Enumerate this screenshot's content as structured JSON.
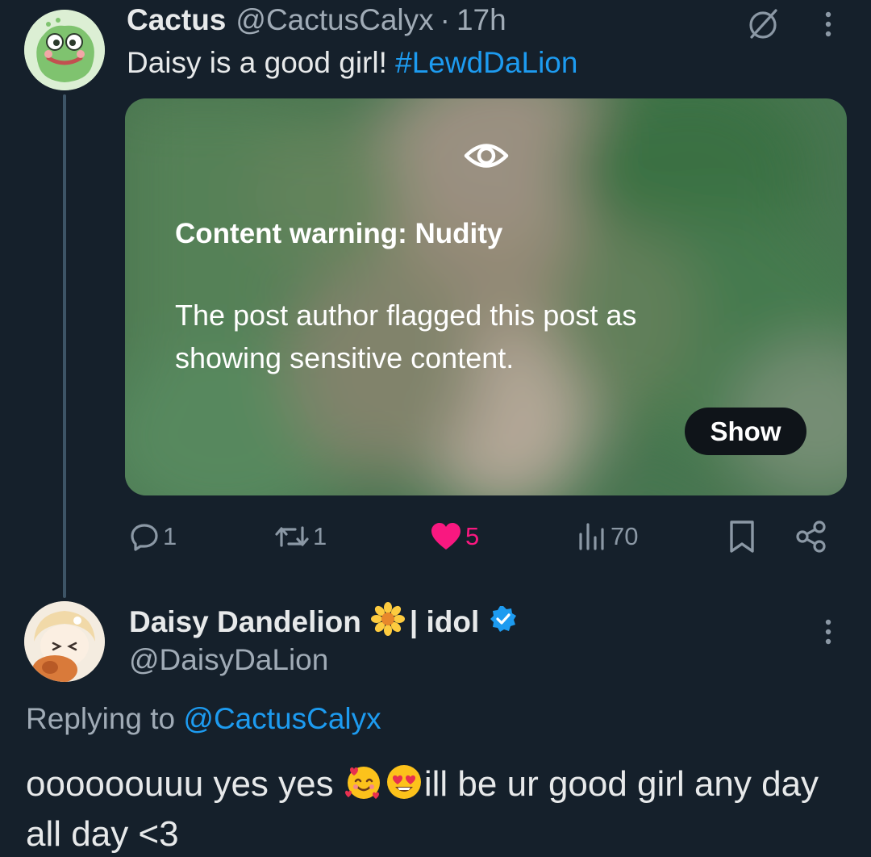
{
  "tweet1": {
    "author_name": "Cactus",
    "handle": "@CactusCalyx",
    "separator": "·",
    "time": "17h",
    "text": "Daisy is a good girl! ",
    "hashtag": "#LewdDaLion",
    "icons": {
      "mute": "mute-icon",
      "more": "more-options-icon"
    },
    "media": {
      "warning_title": "Content warning: Nudity",
      "warning_body": "The post author flagged this post as showing sensitive content.",
      "show_label": "Show",
      "icon": "eye-icon"
    },
    "actions": {
      "replies": "1",
      "retweets": "1",
      "likes": "5",
      "views": "70"
    }
  },
  "tweet2": {
    "author_name": "Daisy Dandelion",
    "name_suffix": "| idol",
    "handle": "@DaisyDaLion",
    "replying_prefix": "Replying to",
    "replying_to": "@CactusCalyx",
    "text_part1": "oooooouuu yes yes",
    "text_part2": "ill be ur good girl any day all day <3",
    "verified": true
  },
  "colors": {
    "background": "#15202b",
    "accent": "#1d9bf0",
    "like": "#f91880",
    "secondary_text": "#8b98a5"
  }
}
